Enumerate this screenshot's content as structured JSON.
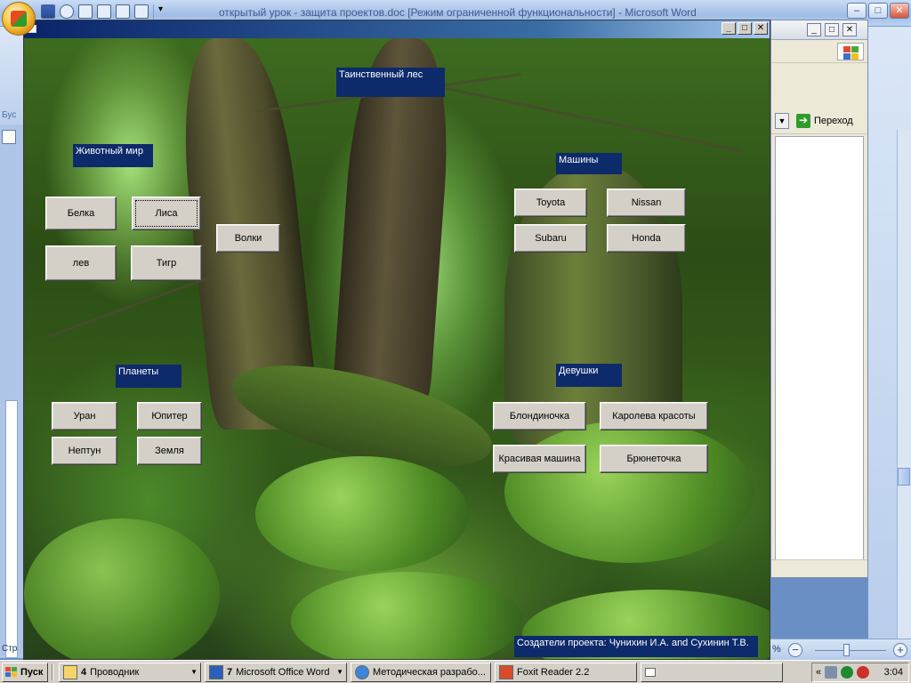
{
  "word": {
    "title": "открытый урок - защита проектов.doc [Режим ограниченной функциональности] - Microsoft Word",
    "zoom_pct": "%",
    "ribbon_left_label": "Бус",
    "status_left_label": "Стр"
  },
  "bg_window": {
    "go_label": "Переход"
  },
  "form": {
    "forest_title": "Таинственный лес",
    "animals": {
      "label": "Животный мир",
      "buttons": [
        "Белка",
        "Лиса",
        "Волки",
        "лев",
        "Тигр"
      ]
    },
    "cars": {
      "label": "Машины",
      "buttons": [
        "Toyota",
        "Nissan",
        "Subaru",
        "Honda"
      ]
    },
    "planets": {
      "label": "Планеты",
      "buttons": [
        "Уран",
        "Юпитер",
        "Нептун",
        "Земля"
      ]
    },
    "girls": {
      "label": "Девушки",
      "buttons": [
        "Блондиночка",
        "Каролева красоты",
        "Красивая машина",
        "Брюнеточка"
      ]
    },
    "credits": "Создатели проекта: Чунихин И.А.  and Сухинин Т.В."
  },
  "taskbar": {
    "start": "Пуск",
    "tasks": [
      {
        "count": "4",
        "label": "Проводник"
      },
      {
        "count": "7",
        "label": "Microsoft Office Word"
      },
      {
        "count": "",
        "label": "Методическая разрабо..."
      },
      {
        "count": "",
        "label": "Foxit Reader 2.2"
      }
    ],
    "tray_chevron": "«",
    "clock": "3:04"
  },
  "colors": {
    "label_bg": "#0d2a6b",
    "button_face": "#d4d0c8",
    "form_title_start": "#0a246a",
    "form_title_end": "#a6caf0"
  }
}
